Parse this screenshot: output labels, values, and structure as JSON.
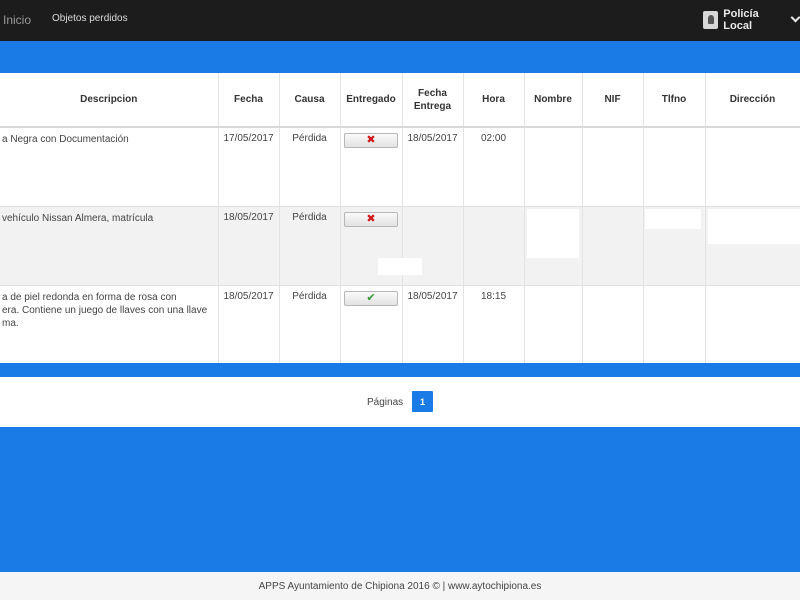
{
  "nav": {
    "home": "Inicio",
    "lost_objects": "Objetos perdidos",
    "user_menu": "Policía Local"
  },
  "table": {
    "headers": {
      "descripcion": "Descripcion",
      "fecha": "Fecha",
      "causa": "Causa",
      "entregado": "Entregado",
      "fecha_entrega": "Fecha Entrega",
      "hora": "Hora",
      "nombre": "Nombre",
      "nif": "NIF",
      "tlfno": "Tlfno",
      "direccion": "Dirección"
    },
    "rows": [
      {
        "descripcion": "a Negra con Documentación",
        "fecha": "17/05/2017",
        "causa": "Pérdida",
        "entregado": false,
        "entregado_icon": "x-icon",
        "fecha_entrega": "18/05/2017",
        "hora": "02:00",
        "nombre": "",
        "nif": "",
        "tlfno": "",
        "direccion": ""
      },
      {
        "descripcion": "vehículo Nissan Almera, matrícula",
        "fecha": "18/05/2017",
        "causa": "Pérdida",
        "entregado": false,
        "entregado_icon": "x-icon",
        "fecha_entrega": "",
        "hora": "",
        "nombre": "",
        "nif": "",
        "tlfno": "",
        "direccion": ""
      },
      {
        "descripcion": "a de piel redonda en forma de rosa con\nera. Contiene un juego de llaves con una llave\nma.",
        "fecha": "18/05/2017",
        "causa": "Pérdida",
        "entregado": true,
        "entregado_icon": "check-icon",
        "fecha_entrega": "18/05/2017",
        "hora": "18:15",
        "nombre": "",
        "nif": "",
        "tlfno": "",
        "direccion": ""
      }
    ]
  },
  "pager": {
    "label": "Páginas",
    "current": "1"
  },
  "footer": {
    "text": "APPS Ayuntamiento de Chipiona 2016 © | www.aytochipiona.es"
  },
  "colors": {
    "brand_blue": "#1a7ae6",
    "topbar": "#1c1c1c",
    "delete_red": "#d0181a",
    "ok_green": "#2f9c2f"
  }
}
